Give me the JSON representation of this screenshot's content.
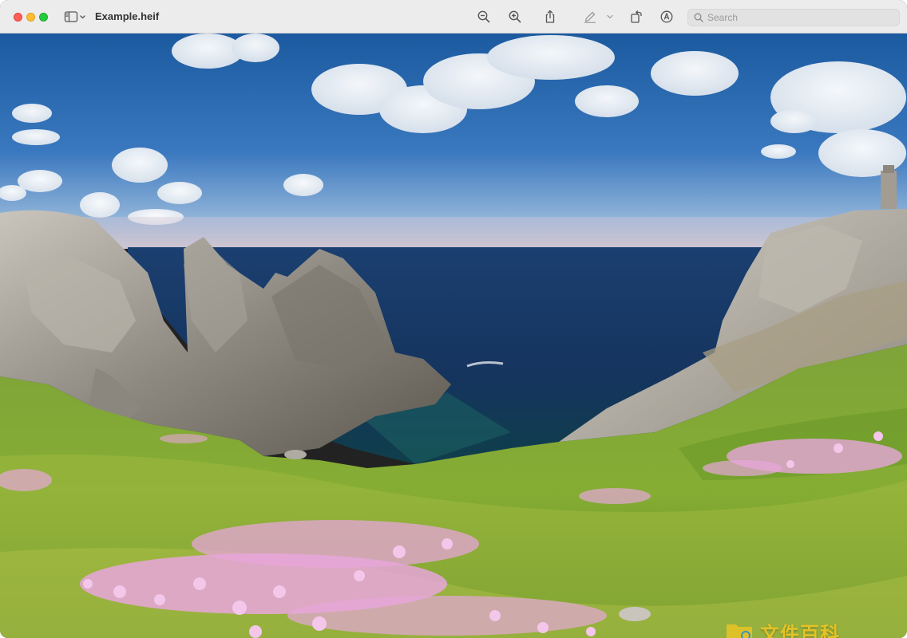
{
  "window": {
    "title": "Example.heif"
  },
  "toolbar": {
    "buttons": [
      {
        "name": "zoom-out",
        "icon": "zoom-out-icon"
      },
      {
        "name": "zoom-in",
        "icon": "zoom-in-icon"
      },
      {
        "name": "share",
        "icon": "share-icon"
      },
      {
        "name": "markup",
        "icon": "pencil-icon"
      },
      {
        "name": "rotate",
        "icon": "rotate-icon"
      },
      {
        "name": "annotate",
        "icon": "pen-circle-icon"
      }
    ],
    "search": {
      "placeholder": "Search",
      "value": ""
    }
  },
  "image": {
    "description_tag": "coastal-cliffs-photo"
  },
  "watermark": {
    "text": "文件百科"
  },
  "colors": {
    "toolbar_bg": "#ececec",
    "close": "#fe5f57",
    "minimize": "#febc2e",
    "maximize": "#28c840",
    "icon": "#555555"
  }
}
